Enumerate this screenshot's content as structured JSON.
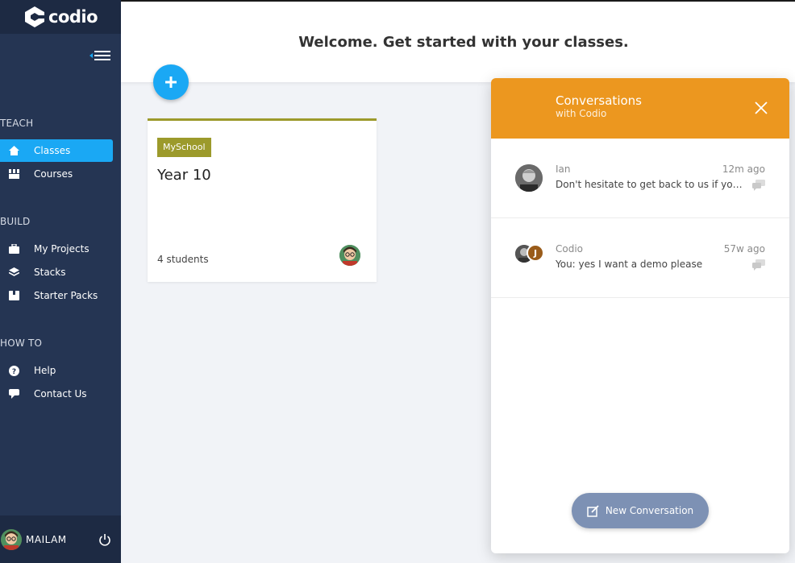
{
  "app": {
    "logo_text": "codio"
  },
  "sidebar": {
    "sections": [
      {
        "label": "TEACH"
      },
      {
        "label": "BUILD"
      },
      {
        "label": "HOW TO"
      }
    ],
    "items": [
      {
        "label": "Classes",
        "icon": "home-icon",
        "active": true
      },
      {
        "label": "Courses",
        "icon": "courses-icon"
      },
      {
        "label": "My Projects",
        "icon": "briefcase-icon"
      },
      {
        "label": "Stacks",
        "icon": "layers-icon"
      },
      {
        "label": "Starter Packs",
        "icon": "package-icon"
      },
      {
        "label": "Help",
        "icon": "help-icon"
      },
      {
        "label": "Contact Us",
        "icon": "chat-icon"
      }
    ],
    "user": {
      "name": "MAILAM"
    }
  },
  "header": {
    "welcome": "Welcome. Get started with your classes."
  },
  "class_card": {
    "school": "MySchool",
    "title": "Year 10",
    "students": "4 students"
  },
  "conversations": {
    "title": "Conversations",
    "subtitle": "with Codio",
    "items": [
      {
        "name": "Ian",
        "time": "12m ago",
        "message": "Don't hesitate to get back to us if you have any questions"
      },
      {
        "name": "Codio",
        "time": "57w ago",
        "message": "You: yes I want a demo please",
        "avatar_letter": "J"
      }
    ],
    "new_button": "New Conversation"
  },
  "colors": {
    "sidebar_bg": "#253553",
    "accent_blue": "#1aa8f4",
    "card_olive": "#9c9a2b",
    "convo_orange": "#ec971f",
    "new_convo_btn": "#7d91b4"
  }
}
